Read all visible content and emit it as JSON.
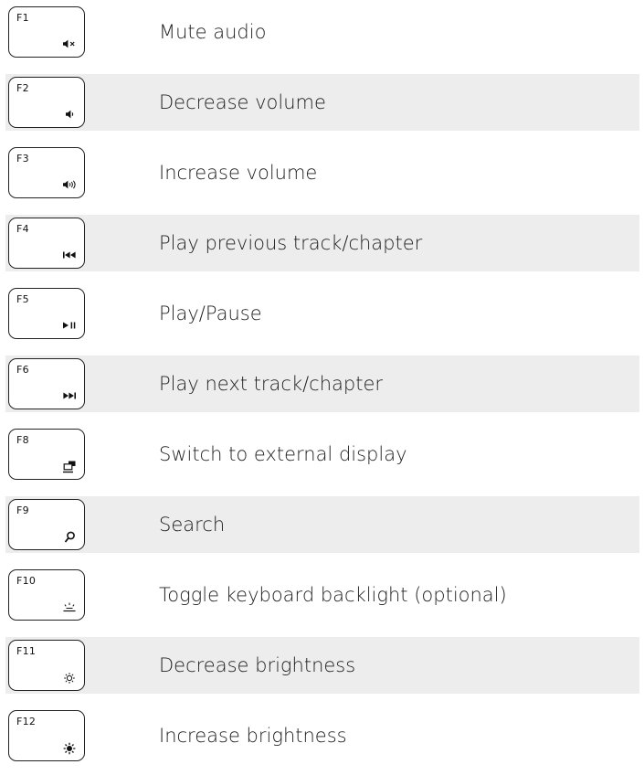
{
  "rows": [
    {
      "key": "F1",
      "icon": "mute-icon",
      "description": "Mute audio"
    },
    {
      "key": "F2",
      "icon": "volume-down-icon",
      "description": "Decrease volume"
    },
    {
      "key": "F3",
      "icon": "volume-up-icon",
      "description": "Increase volume"
    },
    {
      "key": "F4",
      "icon": "previous-track-icon",
      "description": "Play previous track/chapter"
    },
    {
      "key": "F5",
      "icon": "play-pause-icon",
      "description": "Play/Pause"
    },
    {
      "key": "F6",
      "icon": "next-track-icon",
      "description": "Play next track/chapter"
    },
    {
      "key": "F8",
      "icon": "external-display-icon",
      "description": "Switch to external display"
    },
    {
      "key": "F9",
      "icon": "search-icon",
      "description": "Search"
    },
    {
      "key": "F10",
      "icon": "keyboard-backlight-icon",
      "description": "Toggle keyboard backlight (optional)"
    },
    {
      "key": "F11",
      "icon": "brightness-down-icon",
      "description": "Decrease brightness"
    },
    {
      "key": "F12",
      "icon": "brightness-up-icon",
      "description": "Increase brightness"
    }
  ],
  "colors": {
    "shaded_row": "#ededed",
    "key_border": "#222222",
    "text": "#1e1e1e"
  }
}
